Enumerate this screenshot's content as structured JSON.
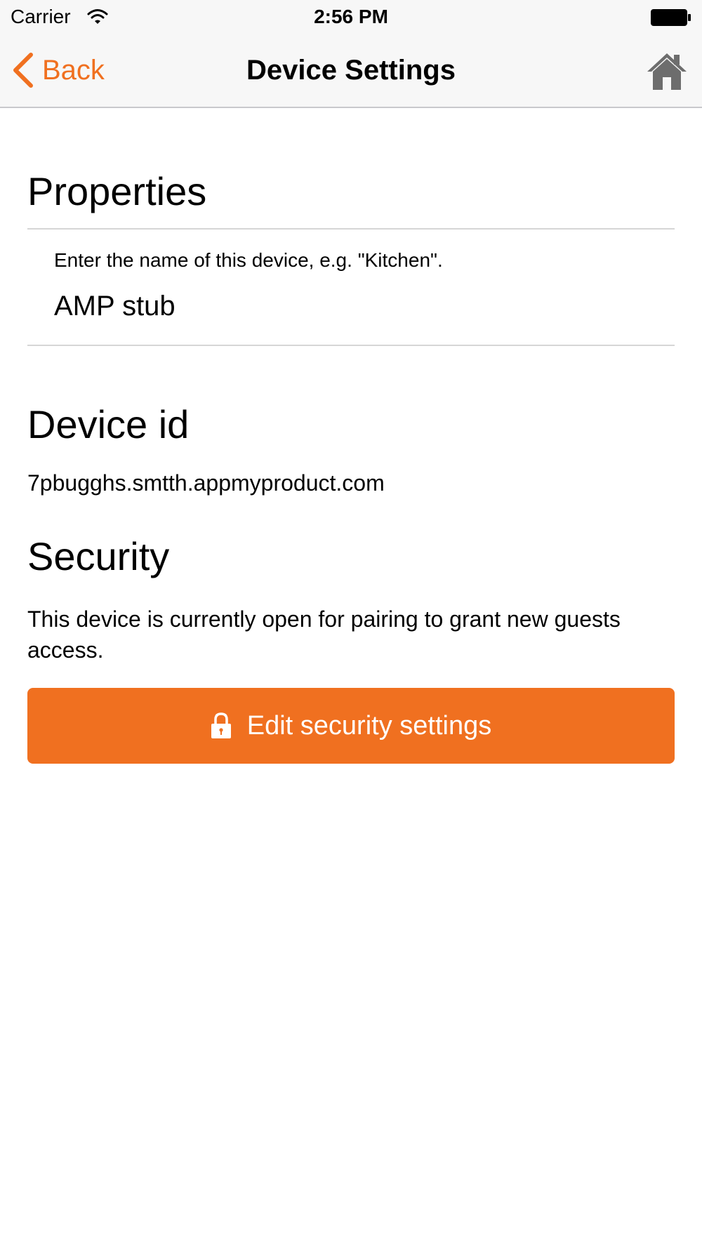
{
  "status_bar": {
    "carrier": "Carrier",
    "time": "2:56 PM"
  },
  "nav": {
    "back_label": "Back",
    "title": "Device Settings",
    "home_icon": "home-icon"
  },
  "properties": {
    "heading": "Properties",
    "name_hint": "Enter the name of this device, e.g. \"Kitchen\".",
    "name_value": "AMP stub"
  },
  "device_id": {
    "heading": "Device id",
    "value": "7pbugghs.smtth.appmyproduct.com"
  },
  "security": {
    "heading": "Security",
    "description": "This device is currently open for pairing to grant new guests access.",
    "button_label": "Edit security settings",
    "button_icon": "lock-icon"
  },
  "colors": {
    "accent": "#f07020",
    "nav_background": "#f7f7f7",
    "home_icon": "#6d6d6d"
  }
}
